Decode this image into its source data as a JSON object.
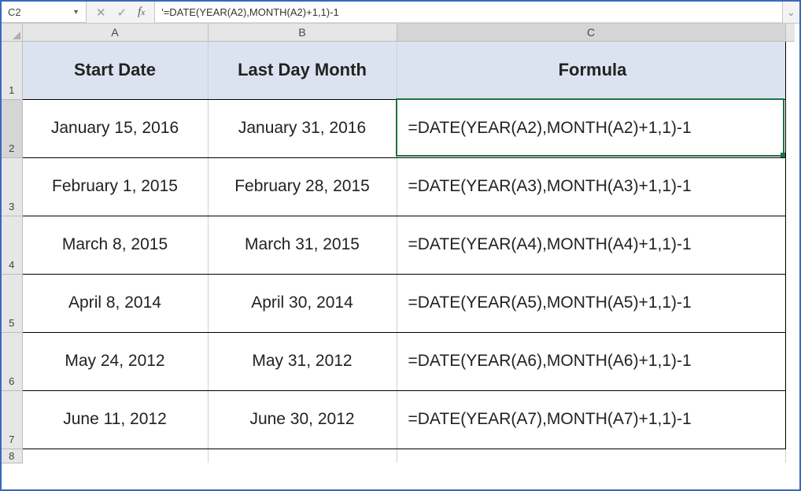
{
  "formula_bar": {
    "cell_ref": "C2",
    "formula": "'=DATE(YEAR(A2),MONTH(A2)+1,1)-1"
  },
  "columns": [
    "A",
    "B",
    "C"
  ],
  "row_labels": [
    "1",
    "2",
    "3",
    "4",
    "5",
    "6",
    "7",
    "8"
  ],
  "headers": {
    "a": "Start Date",
    "b": "Last Day Month",
    "c": "Formula"
  },
  "rows": [
    {
      "a": "January 15, 2016",
      "b": "January 31, 2016",
      "c": "=DATE(YEAR(A2),MONTH(A2)+1,1)-1"
    },
    {
      "a": "February 1, 2015",
      "b": "February 28, 2015",
      "c": "=DATE(YEAR(A3),MONTH(A3)+1,1)-1"
    },
    {
      "a": "March 8, 2015",
      "b": "March 31, 2015",
      "c": "=DATE(YEAR(A4),MONTH(A4)+1,1)-1"
    },
    {
      "a": "April 8, 2014",
      "b": "April 30, 2014",
      "c": "=DATE(YEAR(A5),MONTH(A5)+1,1)-1"
    },
    {
      "a": "May 24, 2012",
      "b": "May 31, 2012",
      "c": "=DATE(YEAR(A6),MONTH(A6)+1,1)-1"
    },
    {
      "a": "June 11, 2012",
      "b": "June 30, 2012",
      "c": "=DATE(YEAR(A7),MONTH(A7)+1,1)-1"
    }
  ],
  "selection": {
    "col": "C",
    "row": 2
  }
}
